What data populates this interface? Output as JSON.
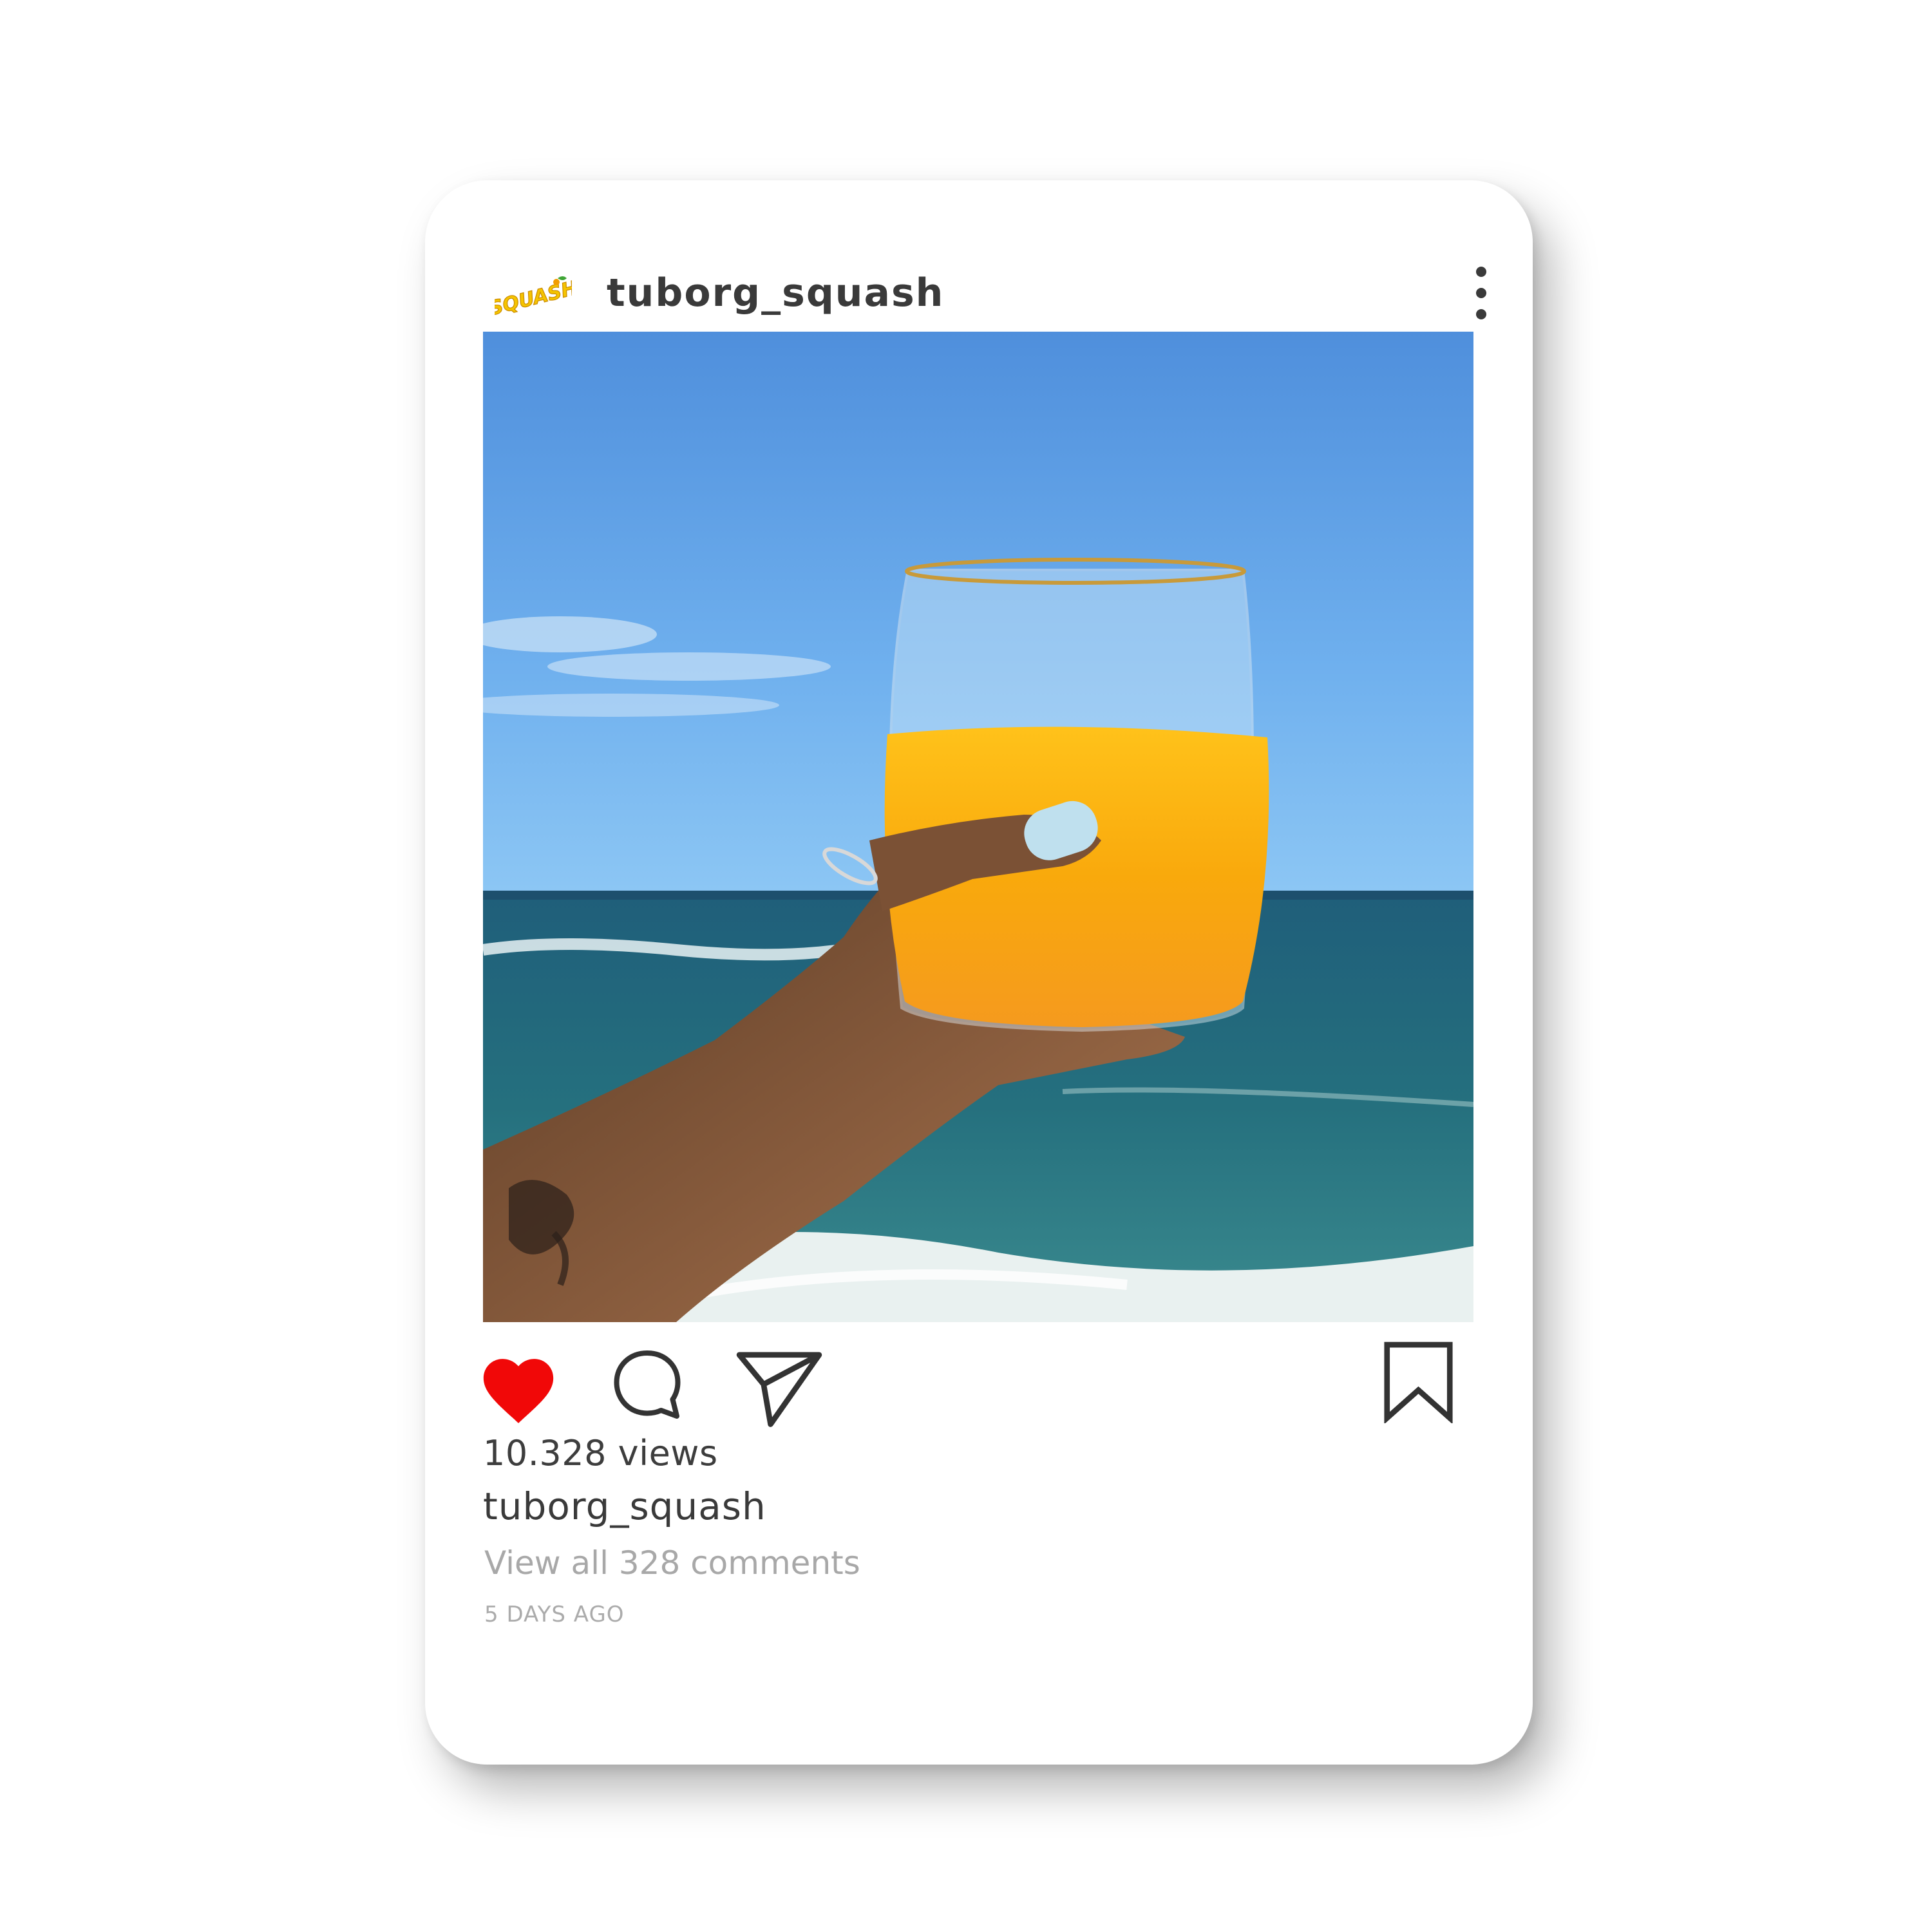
{
  "post": {
    "header": {
      "avatar_logo_text": "SQUASH",
      "username": "tuborg_squash"
    },
    "photo": {
      "alt": ""
    },
    "actions": {
      "liked": true,
      "like_color": "#f10808",
      "icons": [
        "heart-icon",
        "comment-bubble-icon",
        "paper-plane-icon",
        "bookmark-icon"
      ]
    },
    "views": "10.328 views",
    "caption_username": "tuborg_squash",
    "view_comments": "View all 328 comments",
    "timestamp": "5 DAYS AGO"
  },
  "colors": {
    "text_dark": "#3a3a3a",
    "text_muted": "#a8a8a8",
    "brand_yellow": "#f5c400"
  }
}
